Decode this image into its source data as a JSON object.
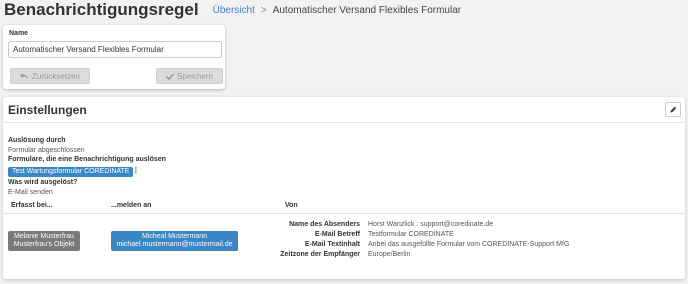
{
  "header": {
    "title": "Benachrichtigungsregel",
    "breadcrumb_link": "Übersicht",
    "breadcrumb_separator": ">",
    "breadcrumb_current": "Automatischer Versand Flexibles Formular"
  },
  "form": {
    "name_label": "Name",
    "name_value": "Automatischer Versand Flexibles Formular",
    "reset_label": "Zurücksetzen",
    "save_label": "Speichern"
  },
  "settings": {
    "title": "Einstellungen",
    "trigger_label": "Auslösung durch",
    "trigger_value": "Formular abgeschlossen",
    "forms_label": "Formulare, die eine Benachrichtigung auslösen",
    "forms_chip": "Test Wartungsformular COREDINATE",
    "action_label": "Was wird ausgelöst?",
    "action_value": "E-Mail senden",
    "table": {
      "col1": "Erfasst bei...",
      "col2": "...melden an",
      "col3": "Von",
      "recorded_by_line1": "Melanie Musterfrau",
      "recorded_by_line2": "Musterfrau's Objekt",
      "notify_line1": "Micheal Mustermann",
      "notify_line2": "michael.mustermann@mustermail.de",
      "details": [
        {
          "key": "Name des Absenders",
          "value": "Horst Wanzlick : support@coredinate.de"
        },
        {
          "key": "E-Mail Betreff",
          "value": "Testformular COREDINATE"
        },
        {
          "key": "E-Mail Textinhalt",
          "value": "Anbei das ausgefüllte Formular vom COREDINATE-Support MfG"
        },
        {
          "key": "Zeitzone der Empfänger",
          "value": "Europe/Berlin"
        }
      ]
    }
  },
  "colors": {
    "accent": "#3b86c4",
    "chip_gray": "#7a7a7a",
    "background": "#f2f2f2"
  },
  "icons": {
    "reset": "undo-arrow-icon",
    "save": "checkmark-icon",
    "edit": "pencil-icon"
  }
}
